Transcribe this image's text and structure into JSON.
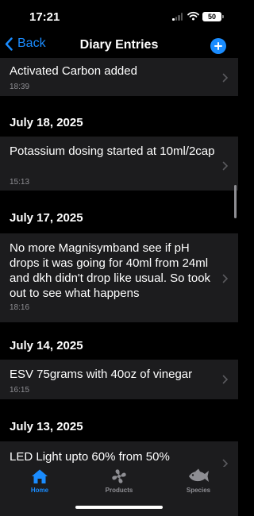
{
  "status": {
    "time": "17:21",
    "battery": "50"
  },
  "nav": {
    "back_label": "Back",
    "title": "Diary Entries"
  },
  "entries": [
    {
      "text": "Activated Carbon added",
      "time": "18:39"
    },
    {
      "date": "July 18, 2025",
      "text": "Potassium dosing started at 10ml/2cap",
      "time": "15:13"
    },
    {
      "date": "July 17, 2025",
      "text": "No more Magnisymband see if pH drops it was going for 40ml from 24ml and dkh didn't drop like usual.  So took out to see what happens",
      "time": "18:16"
    },
    {
      "date": "July 14, 2025",
      "text": "ESV 75grams with 40oz of vinegar",
      "time": "16:15"
    },
    {
      "date": "July 13, 2025",
      "text": "LED Light upto 60% from 50%"
    }
  ],
  "tabs": [
    {
      "label": "Home",
      "icon": "house-icon",
      "active": true
    },
    {
      "label": "Products",
      "icon": "fan-icon",
      "active": false
    },
    {
      "label": "Species",
      "icon": "fish-icon",
      "active": false
    }
  ],
  "colors": {
    "accent": "#1a8cff",
    "background": "#000000",
    "cell": "#1c1c1e",
    "secondary_text": "#8e8e93"
  }
}
